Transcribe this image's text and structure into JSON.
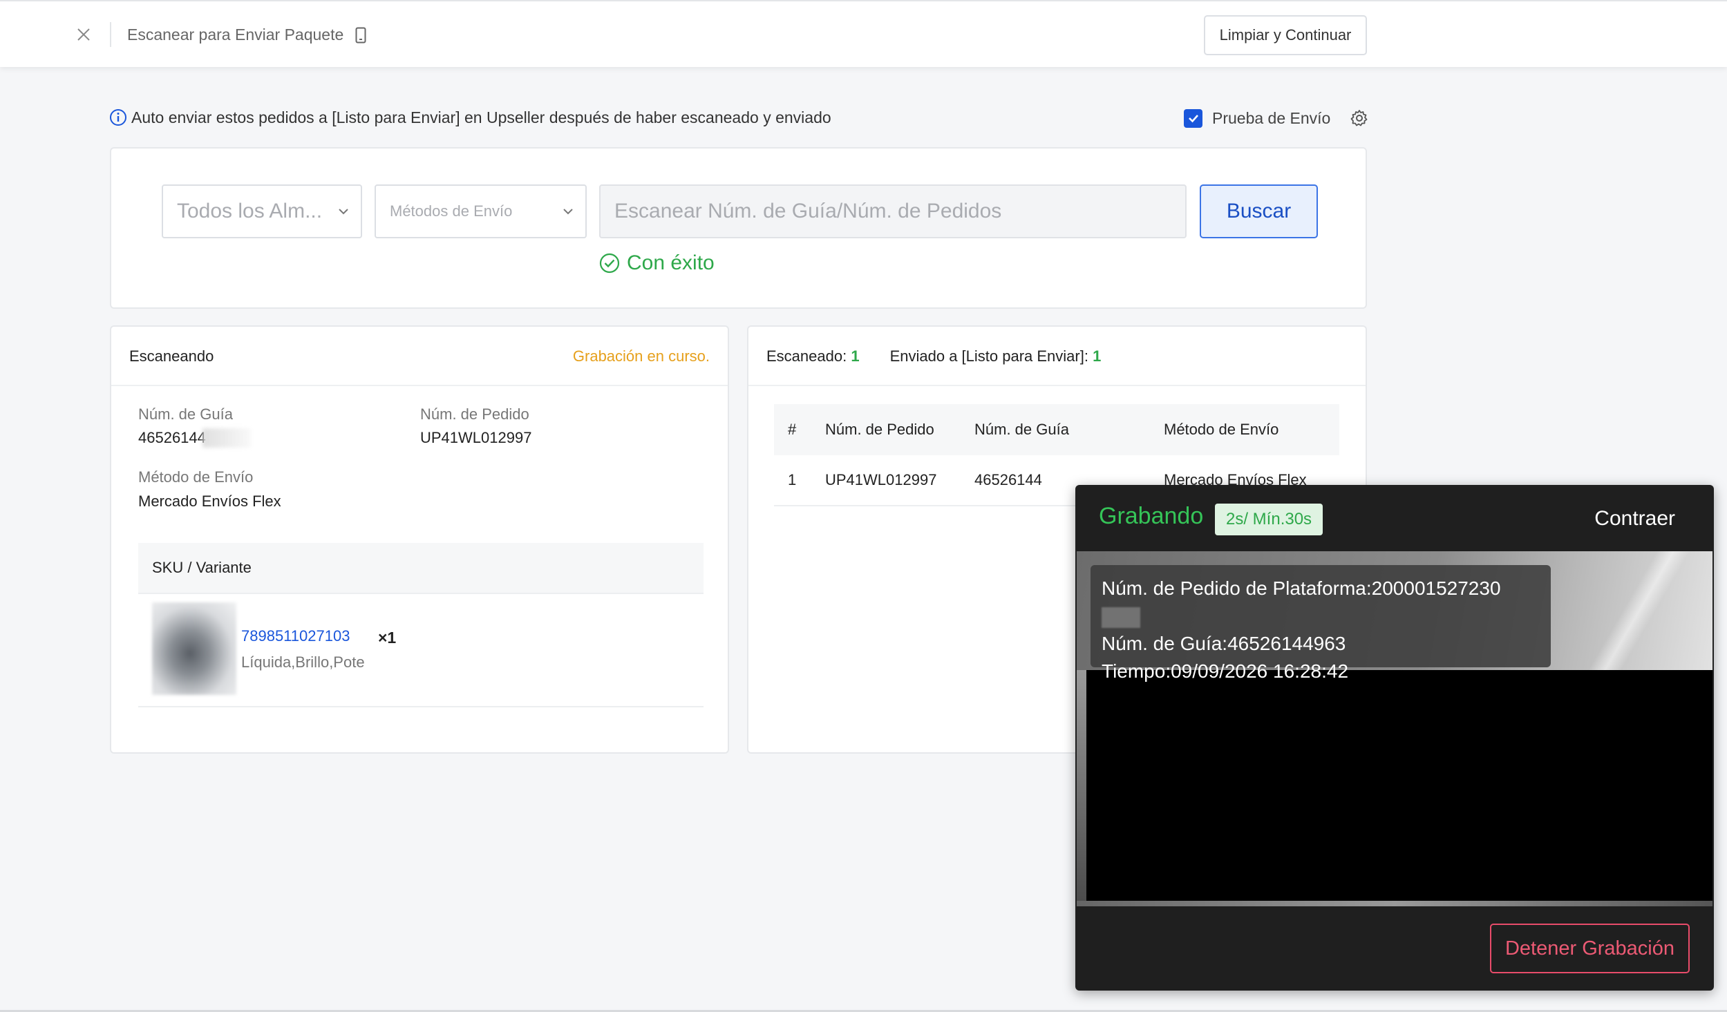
{
  "header": {
    "title": "Escanear para Enviar Paquete",
    "clear_button": "Limpiar y Continuar"
  },
  "info": {
    "text": "Auto enviar estos pedidos a [Listo para Enviar] en Upseller después de haber escaneado y enviado",
    "shipping_test_label": "Prueba de Envío",
    "shipping_test_checked": true
  },
  "search": {
    "warehouse_placeholder": "Todos los Alm...",
    "shipping_method_placeholder": "Métodos de Envío",
    "scan_placeholder": "Escanear Núm. de Guía/Núm. de Pedidos",
    "search_button": "Buscar",
    "status": "Con éxito"
  },
  "scanning": {
    "title": "Escaneando",
    "recording_status": "Grabación en curso.",
    "tracking_label": "Núm. de Guía",
    "tracking_value": "46526144",
    "order_label": "Núm. de Pedido",
    "order_value": "UP41WL012997",
    "shipping_label": "Método de Envío",
    "shipping_value": "Mercado Envíos Flex",
    "sku_header": "SKU / Variante",
    "sku_items": [
      {
        "sku": "7898511027103",
        "variant": "Líquida,Brillo,Pote",
        "qty": "×1"
      }
    ]
  },
  "scanned": {
    "scanned_label": "Escaneado:",
    "scanned_count": "1",
    "sent_label": "Enviado a [Listo para Enviar]:",
    "sent_count": "1",
    "columns": [
      "#",
      "Núm. de Pedido",
      "Núm. de Guía",
      "Método de Envío"
    ],
    "rows": [
      {
        "index": "1",
        "order": "UP41WL012997",
        "tracking": "46526144",
        "method": "Mercado Envíos Flex"
      }
    ]
  },
  "recording": {
    "title": "Grabando",
    "timer": "2s/ Mín.30s",
    "collapse": "Contraer",
    "platform_order_line": "Núm. de Pedido de Plataforma:200001527230",
    "tracking_line": "Núm. de Guía:46526144963",
    "time_line": "Tiempo:09/09/2026 16:28:42",
    "stop_button": "Detener Grabación"
  },
  "colors": {
    "primary": "#1a56db",
    "success": "#2ea84a",
    "warning": "#e6a01c",
    "danger": "#e84c6a",
    "recording_green": "#35c458"
  }
}
